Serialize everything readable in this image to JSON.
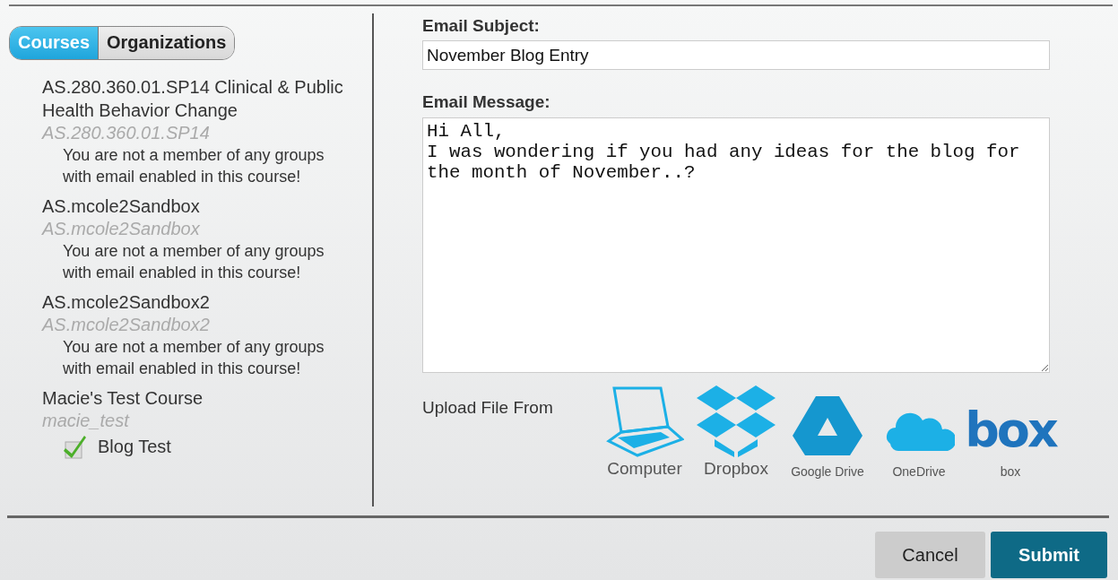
{
  "tabs": [
    {
      "label": "Courses",
      "selected": true
    },
    {
      "label": "Organizations",
      "selected": false
    }
  ],
  "courses": [
    {
      "title": "AS.280.360.01.SP14 Clinical & Public Health Behavior Change",
      "code": "AS.280.360.01.SP14",
      "notice": "You are not a member of any groups with email enabled in this course!"
    },
    {
      "title": "AS.mcole2Sandbox",
      "code": "AS.mcole2Sandbox",
      "notice": "You are not a member of any groups with email enabled in this course!"
    },
    {
      "title": "AS.mcole2Sandbox2",
      "code": "AS.mcole2Sandbox2",
      "notice": "You are not a member of any groups with email enabled in this course!"
    },
    {
      "title": "Macie's Test Course",
      "code": "macie_test",
      "groups": [
        {
          "label": "Blog Test",
          "checked": true
        }
      ]
    }
  ],
  "subject": {
    "label": "Email Subject:",
    "value": "November Blog Entry"
  },
  "message": {
    "label": "Email Message:",
    "value": "Hi All,\nI was wondering if you had any ideas for the blog for the month of November..?"
  },
  "upload": {
    "label": "Upload File From",
    "sources": [
      {
        "kind": "computer",
        "label": "Computer"
      },
      {
        "kind": "dropbox",
        "label": "Dropbox"
      },
      {
        "kind": "gdrive",
        "label": "Google Drive"
      },
      {
        "kind": "onedrive",
        "label": "OneDrive"
      },
      {
        "kind": "box",
        "label": "box",
        "logo": "box"
      }
    ]
  },
  "buttons": [
    {
      "kind": "cancel",
      "label": "Cancel"
    },
    {
      "kind": "submit",
      "label": "Submit"
    }
  ]
}
